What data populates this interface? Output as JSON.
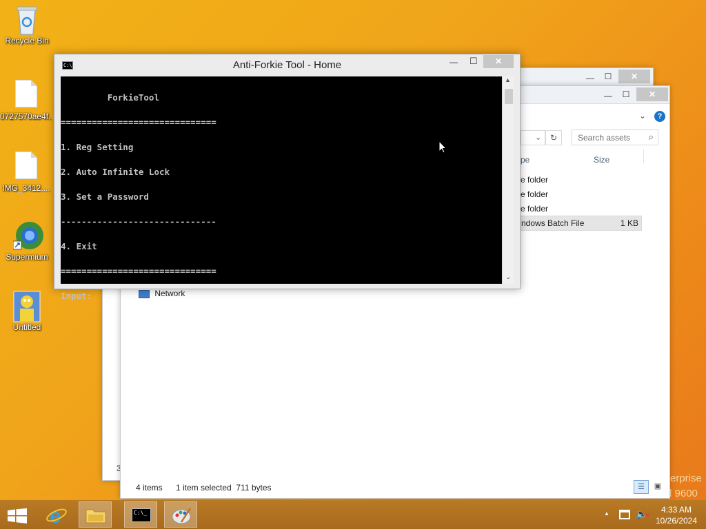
{
  "desktop": {
    "icons": [
      {
        "label": "Recycle Bin",
        "icon": "recycle-bin-icon"
      },
      {
        "label": "0727570ae4f...",
        "icon": "document-icon"
      },
      {
        "label": "IMG_3412....",
        "icon": "document-icon"
      },
      {
        "label": "Supermium",
        "icon": "browser-icon"
      },
      {
        "label": "Untitled",
        "icon": "image-file-icon"
      }
    ],
    "watermark_line1": "erprise",
    "watermark_line2": "d 9600"
  },
  "console": {
    "title": "Anti-Forkie Tool - Home",
    "icon_text": "C:\\",
    "minimize": "—",
    "maximize": "☐",
    "close": "✕",
    "lines": [
      "         ForkieTool",
      "==============================",
      "1. Reg Setting",
      "2. Auto Infinite Lock",
      "3. Set a Password",
      "------------------------------",
      "4. Exit",
      "==============================",
      "Input:"
    ]
  },
  "explorer": {
    "search_placeholder": "Search assets",
    "columns": [
      "pe",
      "Size"
    ],
    "rows": [
      {
        "type": "e folder",
        "size": ""
      },
      {
        "type": "e folder",
        "size": ""
      },
      {
        "type": "e folder",
        "size": ""
      },
      {
        "type": "ndows Batch File",
        "size": "1 KB"
      }
    ],
    "nav_network": "Network",
    "status_items": "4 items",
    "status_selected": "1 item selected  711 bytes",
    "left_partial": "3"
  },
  "taskbar": {
    "time": "4:33 AM",
    "date": "10/26/2024",
    "tray_arrow": "▲"
  },
  "colors": {
    "desktop": "#f0a41a",
    "console_bg": "#000000",
    "console_text": "#c0c0c0",
    "selection": "#e5e5e5"
  }
}
